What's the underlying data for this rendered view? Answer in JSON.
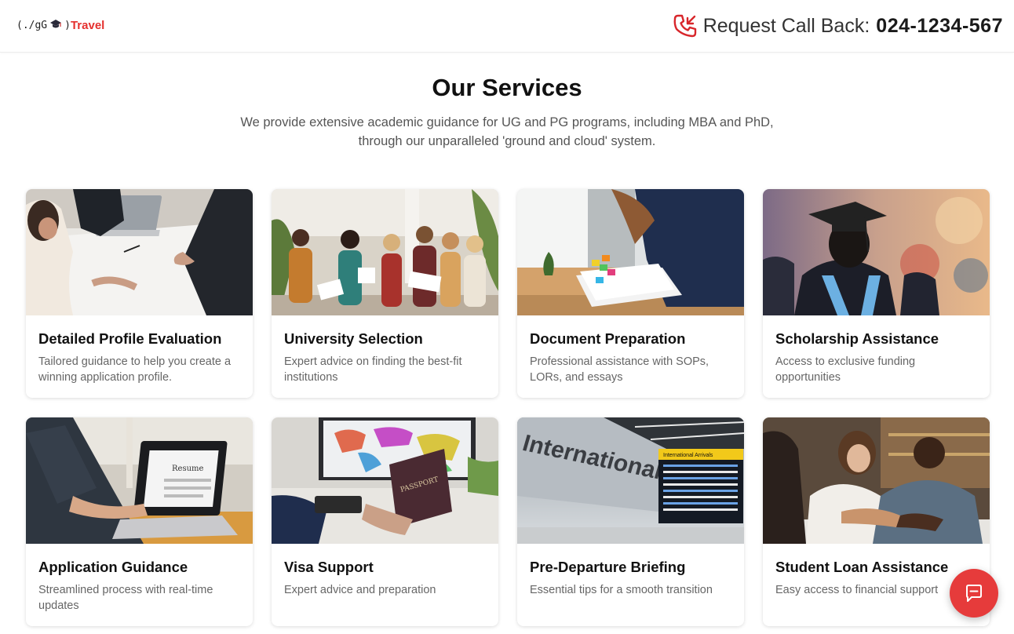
{
  "header": {
    "logo_code": "(./gG",
    "logo_close": ")",
    "logo_brand": "Travel",
    "callback_label": "Request Call Back:",
    "callback_number": "024-1234-567"
  },
  "main": {
    "title": "Our Services",
    "subtitle_line1": "We provide extensive academic guidance for UG and PG programs, including MBA and PhD,",
    "subtitle_line2": "through our unparalleled 'ground and cloud' system."
  },
  "services": [
    {
      "title": "Detailed Profile Evaluation",
      "desc": "Tailored guidance to help you create a winning application profile.",
      "image": "business-meeting-photo"
    },
    {
      "title": "University Selection",
      "desc": "Expert advice on finding the best-fit institutions",
      "image": "students-group-photo"
    },
    {
      "title": "Document Preparation",
      "desc": "Professional assistance with SOPs, LORs, and essays",
      "image": "documents-desk-photo"
    },
    {
      "title": "Scholarship Assistance",
      "desc": "Access to exclusive funding opportunities",
      "image": "graduation-cap-photo"
    },
    {
      "title": "Application Guidance",
      "desc": "Streamlined process with real-time updates",
      "image": "laptop-resume-photo"
    },
    {
      "title": "Visa Support",
      "desc": "Expert advice and preparation",
      "image": "passport-map-photo"
    },
    {
      "title": "Pre-Departure Briefing",
      "desc": "Essential tips for a smooth transition",
      "image": "airport-international-photo"
    },
    {
      "title": "Student Loan Assistance",
      "desc": "Easy access to financial support",
      "image": "handshake-photo"
    }
  ],
  "photo_text": {
    "resume": "Resume",
    "passport": "PASSPORT",
    "international": "International",
    "arrivals": "International Arrivals"
  },
  "colors": {
    "brand_red": "#e5302e",
    "chat_button": "#e63b3b",
    "text_dark": "#111111",
    "text_muted": "#666666"
  },
  "icons": {
    "phone": "phone-callback-icon",
    "logo": "graduation-cap-icon",
    "chat": "chat-bubble-icon"
  }
}
